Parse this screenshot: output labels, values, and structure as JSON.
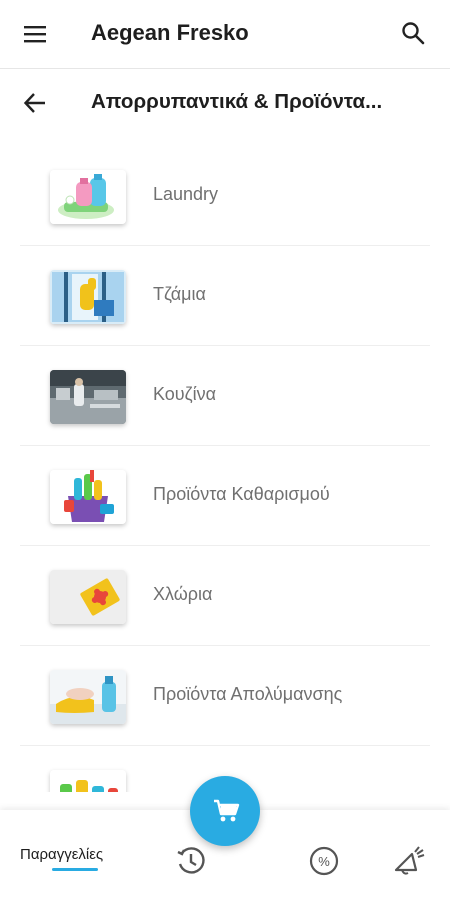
{
  "app": {
    "title": "Aegean Fresko",
    "menu_icon": "hamburger-menu-icon",
    "search_icon": "search-icon"
  },
  "subheader": {
    "title": "Απορρυπαντικά & Προϊόντα...",
    "back_icon": "arrow-left-icon"
  },
  "categories": [
    {
      "label": "Laundry",
      "image": "laundry-detergent-bottles"
    },
    {
      "label": "Τζάμια",
      "image": "window-cleaning"
    },
    {
      "label": "Κουζίνα",
      "image": "kitchen"
    },
    {
      "label": "Προϊόντα Καθαρισμού",
      "image": "cleaning-supplies-bucket"
    },
    {
      "label": "Χλώρια",
      "image": "chlorine-sponge"
    },
    {
      "label": "Προϊόντα Απολύμανσης",
      "image": "disinfection-spray"
    },
    {
      "label": "",
      "image": "cleaning-bottles-partial"
    }
  ],
  "bottom_nav": {
    "orders_label": "Παραγγελίες",
    "history_icon": "history-clock-icon",
    "offers_icon": "percent-icon",
    "announcements_icon": "megaphone-icon",
    "cart_icon": "shopping-cart-icon"
  },
  "colors": {
    "accent": "#29abe2",
    "text_primary": "#1e1e1e",
    "text_secondary": "#707070"
  }
}
